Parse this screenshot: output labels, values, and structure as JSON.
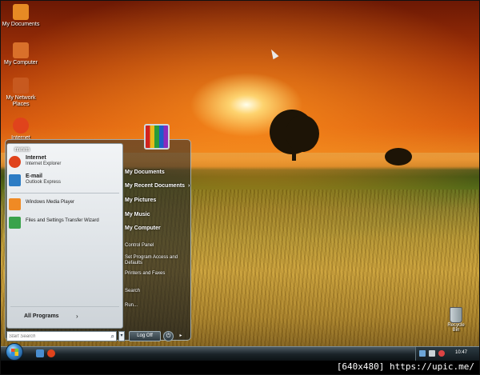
{
  "desktop": {
    "icons": [
      {
        "label": "My Documents",
        "icon": "folder-documents-icon",
        "color": "#e78a24"
      },
      {
        "label": "My Computer",
        "icon": "computer-icon",
        "color": "#d9702a"
      },
      {
        "label": "My Network Places",
        "icon": "network-places-icon",
        "color": "#c7591f"
      },
      {
        "label": "Internet",
        "icon": "internet-explorer-icon",
        "color": "#e0431c"
      }
    ],
    "recycle_bin": {
      "label": "Recycle Bin"
    }
  },
  "start_menu": {
    "user_name": "mnm",
    "pinned": [
      {
        "title": "Internet",
        "subtitle": "Internet Explorer",
        "icon": "internet-explorer-icon",
        "color": "#e0431c"
      },
      {
        "title": "E-mail",
        "subtitle": "Outlook Express",
        "icon": "outlook-express-icon",
        "color": "#2d7cc4"
      }
    ],
    "recent_programs": [
      {
        "label": "Windows Media Player",
        "icon": "media-player-icon",
        "color": "#f08a24"
      },
      {
        "label": "Files and Settings Transfer Wizard",
        "icon": "transfer-wizard-icon",
        "color": "#3aa34b"
      }
    ],
    "all_programs": {
      "label": "All Programs",
      "arrow": "›"
    },
    "right_items": [
      {
        "label": "My Documents",
        "style": "big"
      },
      {
        "label": "My Recent Documents",
        "style": "big",
        "arrow": "›"
      },
      {
        "label": "My Pictures",
        "style": "big"
      },
      {
        "label": "My Music",
        "style": "big"
      },
      {
        "label": "My Computer",
        "style": "big"
      },
      {
        "label": "Control Panel",
        "style": "small"
      },
      {
        "label": "Set Program Access and Defaults",
        "style": "small"
      },
      {
        "label": "Printers and Faxes",
        "style": "small"
      },
      {
        "label": "Search",
        "style": "small"
      },
      {
        "label": "Run...",
        "style": "small"
      }
    ],
    "search": {
      "placeholder": "Start Search"
    },
    "log_off": {
      "label": "Log Off"
    },
    "power_icon": "power-icon"
  },
  "taskbar": {
    "clock": "10:47",
    "accent": "#3d8fd6"
  },
  "watermark": "[640x480] https://upic.me/"
}
